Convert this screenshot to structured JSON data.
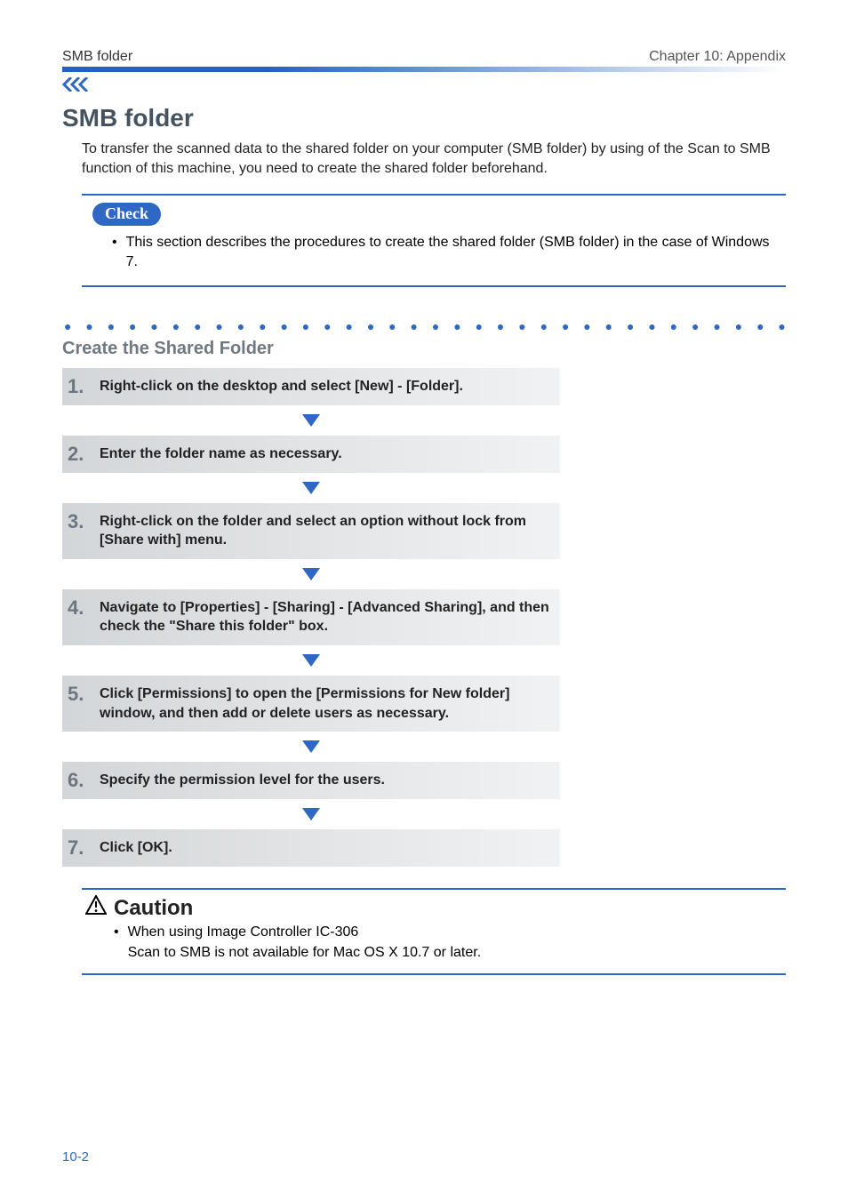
{
  "header": {
    "left": "SMB folder",
    "right": "Chapter 10: Appendix"
  },
  "section": {
    "title": "SMB folder",
    "intro": "To transfer the scanned data to the shared folder on your computer (SMB folder) by using of the Scan to SMB function of this machine, you need to create the shared folder beforehand."
  },
  "check": {
    "label": "Check",
    "text": "This section describes the procedures to create the shared folder (SMB folder) in the case of Windows 7."
  },
  "subsection": {
    "title": "Create the Shared Folder"
  },
  "steps": [
    {
      "num": "1.",
      "text": "Right-click on the desktop and select [New] - [Folder]."
    },
    {
      "num": "2.",
      "text": "Enter the folder name as necessary."
    },
    {
      "num": "3.",
      "text": "Right-click on the folder and select an option without lock from [Share with] menu."
    },
    {
      "num": "4.",
      "text": "Navigate to [Properties] - [Sharing] - [Advanced Sharing], and then check the \"Share this folder\" box."
    },
    {
      "num": "5.",
      "text": "Click [Permissions] to open the [Permissions for New folder] window, and then add or delete users as necessary."
    },
    {
      "num": "6.",
      "text": "Specify the permission level for the users."
    },
    {
      "num": "7.",
      "text": "Click [OK]."
    }
  ],
  "caution": {
    "label": "Caution",
    "line1": "When using Image Controller IC-306",
    "line2": "Scan to SMB is not available for Mac OS X 10.7 or later."
  },
  "footer": {
    "page": "10-2"
  }
}
